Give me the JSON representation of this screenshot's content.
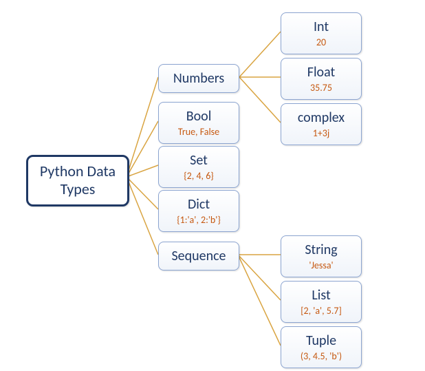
{
  "root": {
    "label": "Python Data\nTypes"
  },
  "level1": {
    "numbers": {
      "label": "Numbers"
    },
    "bool": {
      "label": "Bool",
      "example": "True, False"
    },
    "set": {
      "label": "Set",
      "example": "{2, 4, 6}"
    },
    "dict": {
      "label": "Dict",
      "example": "{1:'a', 2:'b'}"
    },
    "sequence": {
      "label": "Sequence"
    }
  },
  "numbers_children": {
    "int": {
      "label": "Int",
      "example": "20"
    },
    "float": {
      "label": "Float",
      "example": "35.75"
    },
    "complex": {
      "label": "complex",
      "example": "1+3j"
    }
  },
  "sequence_children": {
    "string": {
      "label": "String",
      "example": "'Jessa'"
    },
    "list": {
      "label": "List",
      "example": "[2, 'a', 5.7]"
    },
    "tuple": {
      "label": "Tuple",
      "example": "(3, 4.5, 'b')"
    }
  }
}
